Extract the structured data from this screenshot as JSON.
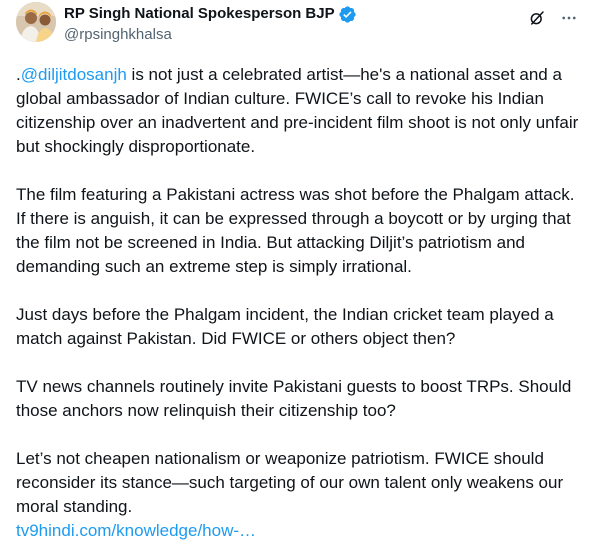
{
  "author": {
    "display_name": "RP Singh National Spokesperson BJP",
    "handle": "@rpsinghkhalsa",
    "verified": true,
    "avatar_icon": "profile-photo",
    "verified_color": "#1d9bf0"
  },
  "actions": {
    "grok_icon": "grok-icon",
    "more_icon": "more-options-icon"
  },
  "tweet": {
    "p1_prefix": ".",
    "p1_mention": "@diljitdosanjh",
    "p1_rest": " is not just a celebrated artist—he's a national asset and a global ambassador of Indian culture. FWICE’s call to revoke his Indian citizenship over an inadvertent and pre-incident film shoot is not only unfair but shockingly disproportionate.",
    "p2": "The film featuring a Pakistani actress was shot before the Phalgam attack. If there is anguish, it can be expressed through a boycott or by urging that the film not be screened in India. But attacking Diljit’s patriotism and demanding such an extreme step is simply irrational.",
    "p3": "Just days before the Phalgam incident, the Indian cricket team played a match against Pakistan. Did FWICE or others object then?",
    "p4": "TV news channels routinely invite Pakistani guests to boost TRPs. Should those anchors now relinquish their citizenship too?",
    "p5": "Let’s not cheapen nationalism or weaponize patriotism. FWICE should reconsider its stance—such targeting of our own talent only weakens our moral standing.",
    "link": "tv9hindi.com/knowledge/how-…"
  },
  "colors": {
    "text": "#0f1419",
    "secondary": "#536471",
    "link": "#1d9bf0"
  }
}
